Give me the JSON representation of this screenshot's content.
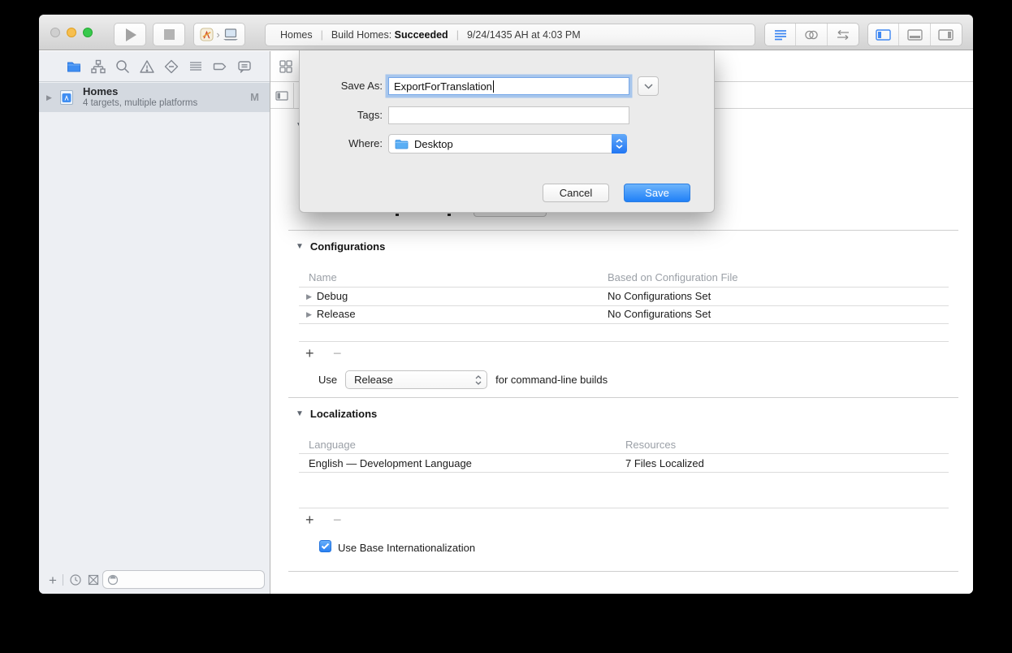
{
  "glyphs": {
    "plus": "+",
    "minus": "−",
    "section_triangle": "▼",
    "row_triangle": "▶",
    "scheme_chevron": "›",
    "pipe": "|"
  },
  "toolbar": {
    "status": {
      "project": "Homes",
      "build_prefix": "Build Homes:",
      "build_result": "Succeeded",
      "timestamp": "9/24/1435 AH at 4:03 PM"
    }
  },
  "sidebar": {
    "project_name": "Homes",
    "project_subtitle": "4 targets, multiple platforms",
    "modified_badge": "M",
    "filter_placeholder": ""
  },
  "editor": {
    "configurations": {
      "title": "Configurations",
      "col_name": "Name",
      "col_file": "Based on Configuration File",
      "rows": [
        {
          "name": "Debug",
          "file": "No Configurations Set"
        },
        {
          "name": "Release",
          "file": "No Configurations Set"
        }
      ],
      "use_prefix": "Use",
      "use_value": "Release",
      "use_suffix": "for command-line builds"
    },
    "localizations": {
      "title": "Localizations",
      "col_language": "Language",
      "col_resources": "Resources",
      "rows": [
        {
          "language": "English — Development Language",
          "resources": "7 Files Localized"
        }
      ],
      "base_intl_label": "Use Base Internationalization"
    }
  },
  "dialog": {
    "save_as_label": "Save As:",
    "filename": "ExportForTranslation",
    "tags_label": "Tags:",
    "tags_value": "",
    "where_label": "Where:",
    "where_value": "Desktop",
    "cancel": "Cancel",
    "save": "Save"
  },
  "colors": {
    "accent_blue": "#3b82f7",
    "selection_gray": "#d4d9e0",
    "dialog_bg": "#ebebeb"
  }
}
